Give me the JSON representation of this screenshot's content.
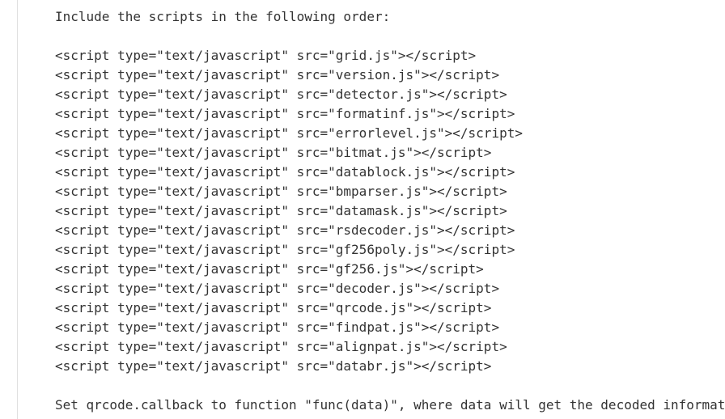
{
  "colors": {
    "background": "#ffffff",
    "text": "#333333",
    "rule": "#e0e0e0"
  },
  "document": {
    "intro_text": "Include the scripts in the following order:",
    "script_tag_prefix": "<script type=\"text/javascript\" src=\"",
    "script_tag_suffix": "\"></script>",
    "script_lines": [
      "<script type=\"text/javascript\" src=\"grid.js\"></script>",
      "<script type=\"text/javascript\" src=\"version.js\"></script>",
      "<script type=\"text/javascript\" src=\"detector.js\"></script>",
      "<script type=\"text/javascript\" src=\"formatinf.js\"></script>",
      "<script type=\"text/javascript\" src=\"errorlevel.js\"></script>",
      "<script type=\"text/javascript\" src=\"bitmat.js\"></script>",
      "<script type=\"text/javascript\" src=\"datablock.js\"></script>",
      "<script type=\"text/javascript\" src=\"bmparser.js\"></script>",
      "<script type=\"text/javascript\" src=\"datamask.js\"></script>",
      "<script type=\"text/javascript\" src=\"rsdecoder.js\"></script>",
      "<script type=\"text/javascript\" src=\"gf256poly.js\"></script>",
      "<script type=\"text/javascript\" src=\"gf256.js\"></script>",
      "<script type=\"text/javascript\" src=\"decoder.js\"></script>",
      "<script type=\"text/javascript\" src=\"qrcode.js\"></script>",
      "<script type=\"text/javascript\" src=\"findpat.js\"></script>",
      "<script type=\"text/javascript\" src=\"alignpat.js\"></script>",
      "<script type=\"text/javascript\" src=\"databr.js\"></script>"
    ],
    "script_sources": [
      "grid.js",
      "version.js",
      "detector.js",
      "formatinf.js",
      "errorlevel.js",
      "bitmat.js",
      "datablock.js",
      "bmparser.js",
      "datamask.js",
      "rsdecoder.js",
      "gf256poly.js",
      "gf256.js",
      "decoder.js",
      "qrcode.js",
      "findpat.js",
      "alignpat.js",
      "databr.js"
    ],
    "closing_text": "Set qrcode.callback to function \"func(data)\", where data will get the decoded information."
  }
}
